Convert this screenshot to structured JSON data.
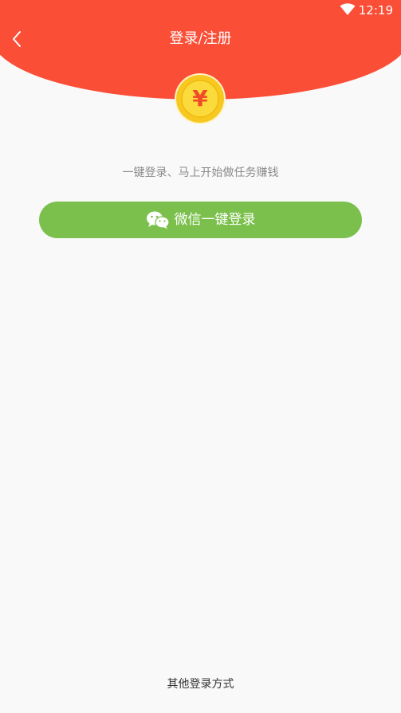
{
  "status_bar": {
    "time": "12:19",
    "wifi_icon": "wifi-icon"
  },
  "nav": {
    "back_icon": "chevron-left-icon",
    "title": "登录/注册"
  },
  "hero": {
    "coin_icon": "gold-coin-yuan-icon",
    "coin_symbol": "¥"
  },
  "tagline": "一键登录、马上开始做任务赚钱",
  "wechat_login": {
    "icon": "wechat-icon",
    "label": "微信一键登录"
  },
  "footer": {
    "other_login_label": "其他登录方式"
  },
  "colors": {
    "header_red": "#fb4e37",
    "button_green": "#7bc04c",
    "coin_gold": "#f7c81f",
    "background": "#f9f9f9"
  }
}
